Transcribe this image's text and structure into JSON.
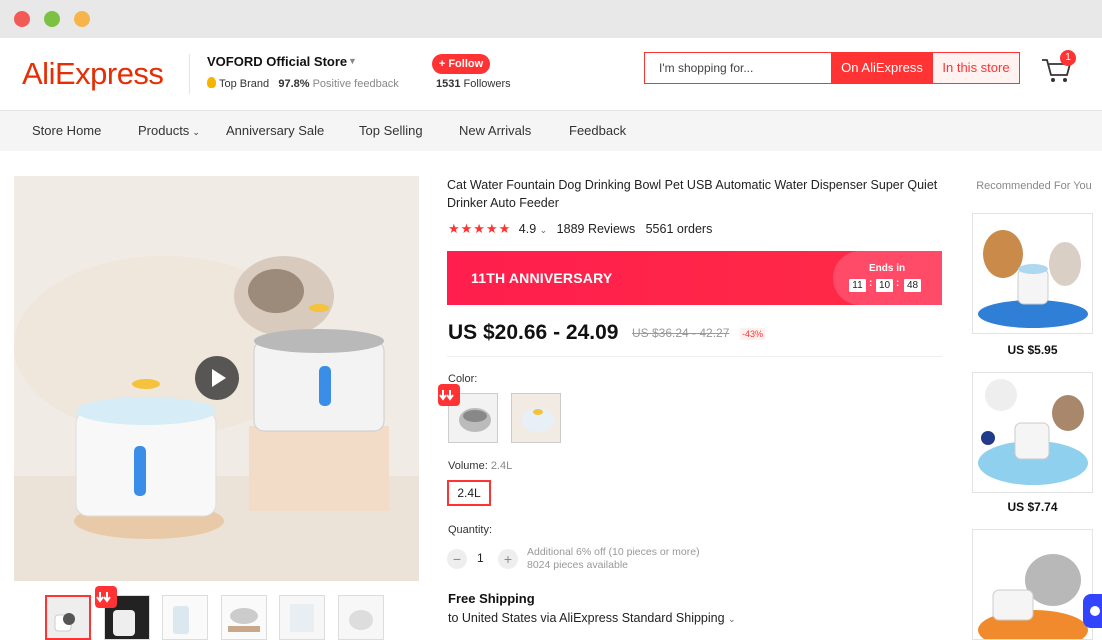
{
  "brand": {
    "logo": "AliExpress"
  },
  "store": {
    "name": "VOFORD Official Store",
    "badge": "Top Brand",
    "feedback_pct": "97.8%",
    "feedback_label": "Positive feedback",
    "follow_label": "+ Follow",
    "followers_count": "1531",
    "followers_label": "Followers"
  },
  "search": {
    "placeholder": "I'm shopping for...",
    "button_ae": "On AliExpress",
    "button_store": "In this store"
  },
  "cart": {
    "count": "1"
  },
  "nav": [
    {
      "label": "Store Home"
    },
    {
      "label": "Products"
    },
    {
      "label": "Anniversary Sale"
    },
    {
      "label": "Top Selling"
    },
    {
      "label": "New Arrivals"
    },
    {
      "label": "Feedback"
    }
  ],
  "product": {
    "title": "Cat Water Fountain Dog Drinking Bowl Pet USB Automatic Water Dispenser Super Quiet Drinker Auto Feeder",
    "rating": "4.9",
    "reviews": "1889 Reviews",
    "orders": "5561 orders",
    "stars_filled": 5
  },
  "promo": {
    "label": "11TH ANNIVERSARY",
    "ends_label": "Ends in",
    "hours": "11",
    "minutes": "10",
    "seconds": "48"
  },
  "pricing": {
    "price": "US $20.66 - 24.09",
    "old_price": "US $36.24 - 42.27",
    "discount": "-43%"
  },
  "options": {
    "color_label": "Color:",
    "volume_label": "Volume:",
    "volume_selected": "2.4L",
    "volume_option": "2.4L"
  },
  "quantity": {
    "label": "Quantity:",
    "value": "1",
    "minus": "−",
    "plus": "+",
    "discount_note": "Additional 6% off (10 pieces or more)",
    "available": "8024 pieces available"
  },
  "shipping": {
    "title": "Free Shipping",
    "detail": "to United States via AliExpress Standard Shipping"
  },
  "recommended": {
    "title": "Recommended For You",
    "items": [
      {
        "price": "US $5.95"
      },
      {
        "price": "US $7.74"
      }
    ]
  },
  "colors": {
    "accent": "#ff3333",
    "logo": "#e62e04",
    "anniversary": "#ff1e4d"
  }
}
